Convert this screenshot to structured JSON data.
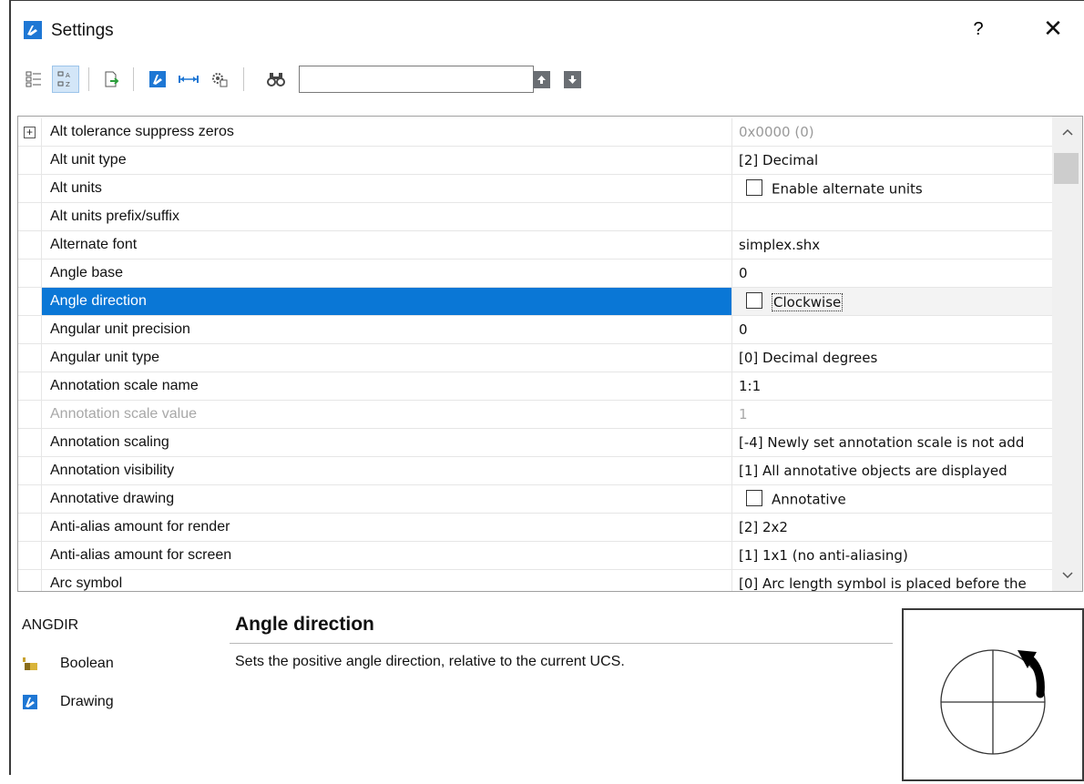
{
  "window": {
    "title": "Settings",
    "help_label": "?",
    "close_label": "✕"
  },
  "toolbar": {
    "search_value": "",
    "buttons": [
      "categorized-view",
      "alphabetical-view",
      "export",
      "drawing-settings",
      "dimension-settings",
      "user-preferences",
      "find"
    ]
  },
  "grid": {
    "rows": [
      {
        "name": "Alt tolerance suppress zeros",
        "value": "0x0000 (0)",
        "expandable": true,
        "value_greyed": true
      },
      {
        "name": "Alt unit type",
        "value": "[2] Decimal"
      },
      {
        "name": "Alt units",
        "checkbox": true,
        "checked": false,
        "value": "Enable alternate units"
      },
      {
        "name": "Alt units prefix/suffix",
        "value": ""
      },
      {
        "name": "Alternate font",
        "value": "simplex.shx"
      },
      {
        "name": "Angle base",
        "value": "0"
      },
      {
        "name": "Angle direction",
        "checkbox": true,
        "checked": false,
        "value": "Clockwise",
        "selected": true
      },
      {
        "name": "Angular unit precision",
        "value": "0"
      },
      {
        "name": "Angular unit type",
        "value": "[0] Decimal degrees"
      },
      {
        "name": "Annotation scale name",
        "value": "1:1"
      },
      {
        "name": "Annotation scale value",
        "value": "1",
        "disabled": true
      },
      {
        "name": "Annotation scaling",
        "value": "[-4] Newly set annotation scale is not add"
      },
      {
        "name": "Annotation visibility",
        "value": "[1] All annotative objects are displayed"
      },
      {
        "name": "Annotative drawing",
        "checkbox": true,
        "checked": false,
        "value": "Annotative"
      },
      {
        "name": "Anti-alias amount for render",
        "value": "[2] 2x2"
      },
      {
        "name": "Anti-alias amount for screen",
        "value": "[1] 1x1 (no anti-aliasing)"
      },
      {
        "name": "Arc symbol",
        "value": "[0] Arc length symbol is placed before the"
      }
    ]
  },
  "description": {
    "code": "ANGDIR",
    "type": "Boolean",
    "scope": "Drawing",
    "title": "Angle direction",
    "text": "Sets the positive angle direction, relative to the current UCS."
  },
  "colors": {
    "selection": "#0a77d6",
    "app_blue": "#1e77d4"
  }
}
